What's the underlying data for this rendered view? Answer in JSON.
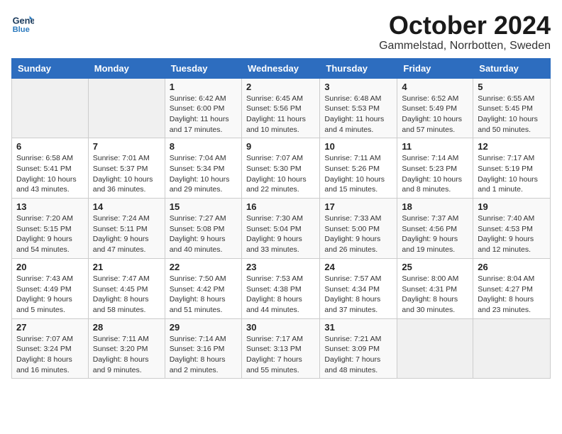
{
  "header": {
    "logo_line1": "General",
    "logo_line2": "Blue",
    "title": "October 2024",
    "subtitle": "Gammelstad, Norrbotten, Sweden"
  },
  "weekdays": [
    "Sunday",
    "Monday",
    "Tuesday",
    "Wednesday",
    "Thursday",
    "Friday",
    "Saturday"
  ],
  "weeks": [
    [
      {
        "day": "",
        "empty": true
      },
      {
        "day": "",
        "empty": true
      },
      {
        "day": "1",
        "sunrise": "6:42 AM",
        "sunset": "6:00 PM",
        "daylight": "Daylight: 11 hours and 17 minutes."
      },
      {
        "day": "2",
        "sunrise": "6:45 AM",
        "sunset": "5:56 PM",
        "daylight": "Daylight: 11 hours and 10 minutes."
      },
      {
        "day": "3",
        "sunrise": "6:48 AM",
        "sunset": "5:53 PM",
        "daylight": "Daylight: 11 hours and 4 minutes."
      },
      {
        "day": "4",
        "sunrise": "6:52 AM",
        "sunset": "5:49 PM",
        "daylight": "Daylight: 10 hours and 57 minutes."
      },
      {
        "day": "5",
        "sunrise": "6:55 AM",
        "sunset": "5:45 PM",
        "daylight": "Daylight: 10 hours and 50 minutes."
      }
    ],
    [
      {
        "day": "6",
        "sunrise": "6:58 AM",
        "sunset": "5:41 PM",
        "daylight": "Daylight: 10 hours and 43 minutes."
      },
      {
        "day": "7",
        "sunrise": "7:01 AM",
        "sunset": "5:37 PM",
        "daylight": "Daylight: 10 hours and 36 minutes."
      },
      {
        "day": "8",
        "sunrise": "7:04 AM",
        "sunset": "5:34 PM",
        "daylight": "Daylight: 10 hours and 29 minutes."
      },
      {
        "day": "9",
        "sunrise": "7:07 AM",
        "sunset": "5:30 PM",
        "daylight": "Daylight: 10 hours and 22 minutes."
      },
      {
        "day": "10",
        "sunrise": "7:11 AM",
        "sunset": "5:26 PM",
        "daylight": "Daylight: 10 hours and 15 minutes."
      },
      {
        "day": "11",
        "sunrise": "7:14 AM",
        "sunset": "5:23 PM",
        "daylight": "Daylight: 10 hours and 8 minutes."
      },
      {
        "day": "12",
        "sunrise": "7:17 AM",
        "sunset": "5:19 PM",
        "daylight": "Daylight: 10 hours and 1 minute."
      }
    ],
    [
      {
        "day": "13",
        "sunrise": "7:20 AM",
        "sunset": "5:15 PM",
        "daylight": "Daylight: 9 hours and 54 minutes."
      },
      {
        "day": "14",
        "sunrise": "7:24 AM",
        "sunset": "5:11 PM",
        "daylight": "Daylight: 9 hours and 47 minutes."
      },
      {
        "day": "15",
        "sunrise": "7:27 AM",
        "sunset": "5:08 PM",
        "daylight": "Daylight: 9 hours and 40 minutes."
      },
      {
        "day": "16",
        "sunrise": "7:30 AM",
        "sunset": "5:04 PM",
        "daylight": "Daylight: 9 hours and 33 minutes."
      },
      {
        "day": "17",
        "sunrise": "7:33 AM",
        "sunset": "5:00 PM",
        "daylight": "Daylight: 9 hours and 26 minutes."
      },
      {
        "day": "18",
        "sunrise": "7:37 AM",
        "sunset": "4:56 PM",
        "daylight": "Daylight: 9 hours and 19 minutes."
      },
      {
        "day": "19",
        "sunrise": "7:40 AM",
        "sunset": "4:53 PM",
        "daylight": "Daylight: 9 hours and 12 minutes."
      }
    ],
    [
      {
        "day": "20",
        "sunrise": "7:43 AM",
        "sunset": "4:49 PM",
        "daylight": "Daylight: 9 hours and 5 minutes."
      },
      {
        "day": "21",
        "sunrise": "7:47 AM",
        "sunset": "4:45 PM",
        "daylight": "Daylight: 8 hours and 58 minutes."
      },
      {
        "day": "22",
        "sunrise": "7:50 AM",
        "sunset": "4:42 PM",
        "daylight": "Daylight: 8 hours and 51 minutes."
      },
      {
        "day": "23",
        "sunrise": "7:53 AM",
        "sunset": "4:38 PM",
        "daylight": "Daylight: 8 hours and 44 minutes."
      },
      {
        "day": "24",
        "sunrise": "7:57 AM",
        "sunset": "4:34 PM",
        "daylight": "Daylight: 8 hours and 37 minutes."
      },
      {
        "day": "25",
        "sunrise": "8:00 AM",
        "sunset": "4:31 PM",
        "daylight": "Daylight: 8 hours and 30 minutes."
      },
      {
        "day": "26",
        "sunrise": "8:04 AM",
        "sunset": "4:27 PM",
        "daylight": "Daylight: 8 hours and 23 minutes."
      }
    ],
    [
      {
        "day": "27",
        "sunrise": "7:07 AM",
        "sunset": "3:24 PM",
        "daylight": "Daylight: 8 hours and 16 minutes."
      },
      {
        "day": "28",
        "sunrise": "7:11 AM",
        "sunset": "3:20 PM",
        "daylight": "Daylight: 8 hours and 9 minutes."
      },
      {
        "day": "29",
        "sunrise": "7:14 AM",
        "sunset": "3:16 PM",
        "daylight": "Daylight: 8 hours and 2 minutes."
      },
      {
        "day": "30",
        "sunrise": "7:17 AM",
        "sunset": "3:13 PM",
        "daylight": "Daylight: 7 hours and 55 minutes."
      },
      {
        "day": "31",
        "sunrise": "7:21 AM",
        "sunset": "3:09 PM",
        "daylight": "Daylight: 7 hours and 48 minutes."
      },
      {
        "day": "",
        "empty": true
      },
      {
        "day": "",
        "empty": true
      }
    ]
  ]
}
